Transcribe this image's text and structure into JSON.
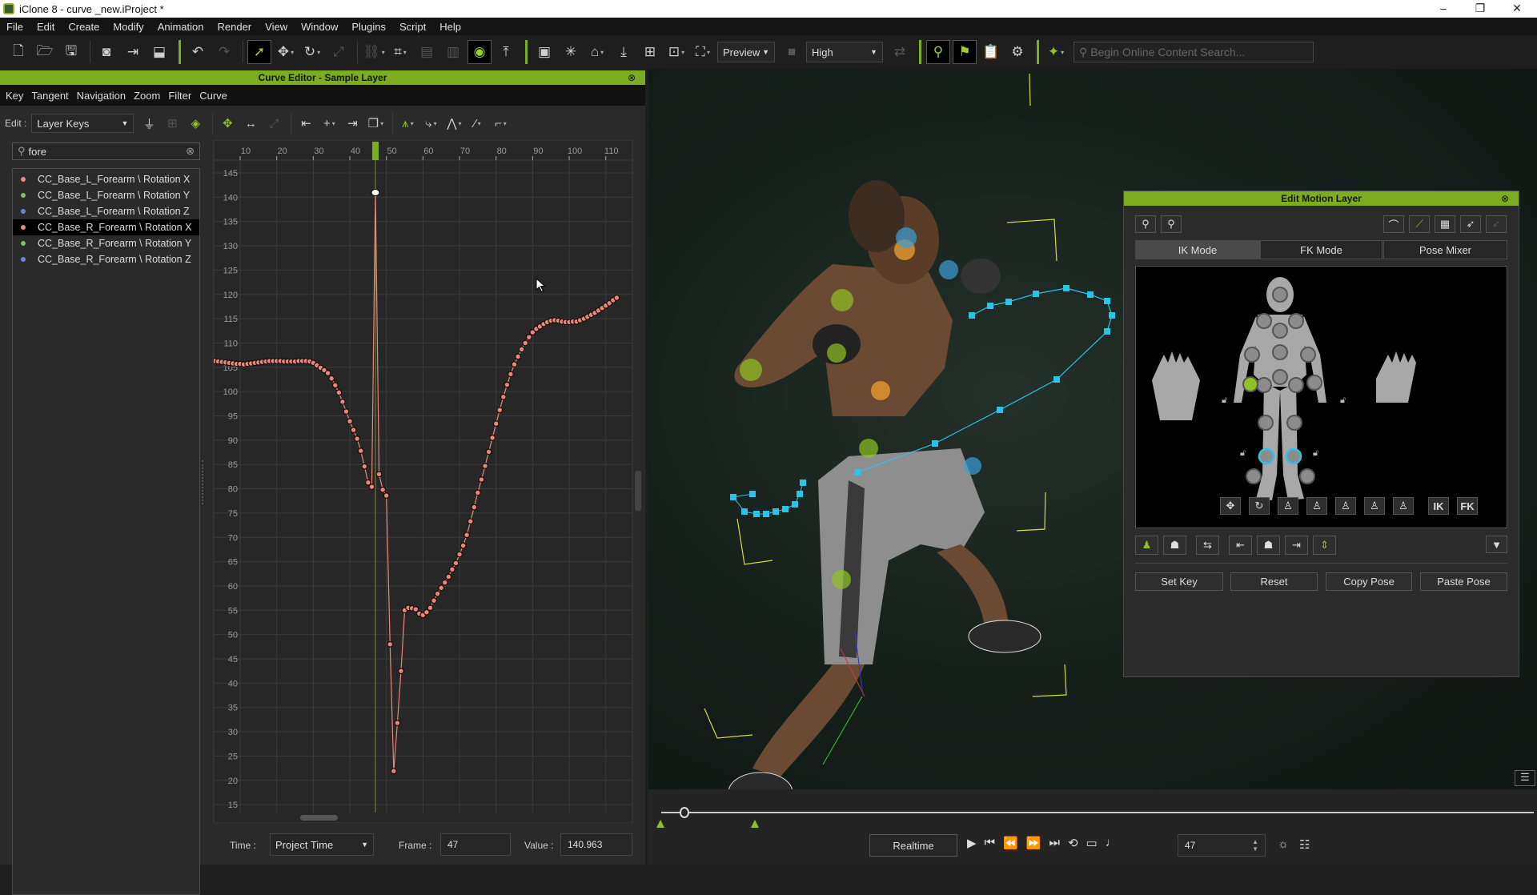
{
  "window": {
    "title": "iClone 8 - curve _new.iProject *",
    "controls": [
      "minimize",
      "maximize",
      "close"
    ]
  },
  "menu": [
    "File",
    "Edit",
    "Create",
    "Modify",
    "Animation",
    "Render",
    "View",
    "Window",
    "Plugins",
    "Script",
    "Help"
  ],
  "toolbar": {
    "groups": [
      [
        {
          "icon": "new-file-icon",
          "g": "🗋"
        },
        {
          "icon": "open-folder-icon",
          "g": "🗁"
        },
        {
          "icon": "save-icon",
          "g": "🖫"
        }
      ],
      [
        {
          "icon": "preview-render-icon",
          "g": "◙"
        },
        {
          "icon": "export-icon",
          "g": "⇥"
        },
        {
          "icon": "export-usd-icon",
          "g": "⬓"
        }
      ],
      "gsep",
      [
        {
          "icon": "undo-icon",
          "g": "↶"
        },
        {
          "icon": "redo-icon",
          "g": "↷",
          "dis": true
        }
      ],
      [
        {
          "icon": "select-icon",
          "g": "➚",
          "act": true
        },
        {
          "icon": "move-icon",
          "g": "✥",
          "dd": true
        },
        {
          "icon": "rotate-icon",
          "g": "↻",
          "dd": true
        },
        {
          "icon": "scale-icon",
          "g": "⤢",
          "dis": true
        }
      ],
      [
        {
          "icon": "link-icon",
          "g": "⛓",
          "dd": true,
          "dis": true
        },
        {
          "icon": "snap-icon",
          "g": "⌗",
          "dd": true
        },
        {
          "icon": "align-left-icon",
          "g": "▤",
          "dis": true
        },
        {
          "icon": "align-right-icon",
          "g": "▥",
          "dis": true
        },
        {
          "icon": "visibility-eye-icon",
          "g": "◉",
          "act": true
        },
        {
          "icon": "pivot-icon",
          "g": "⤒"
        }
      ],
      "gsep",
      [
        {
          "icon": "frame-icon",
          "g": "▣"
        },
        {
          "icon": "light-icon",
          "g": "✳"
        },
        {
          "icon": "home-camera-icon",
          "g": "⌂",
          "dd": true
        },
        {
          "icon": "drop-to-floor-icon",
          "g": "⤓"
        },
        {
          "icon": "center-icon",
          "g": "⊞"
        },
        {
          "icon": "pick-camera-icon",
          "g": "⊡",
          "dd": true
        },
        {
          "icon": "fit-view-icon",
          "g": "⛶",
          "dd": true
        }
      ],
      "preview",
      "camera",
      "high",
      [
        {
          "icon": "sync-icon",
          "g": "⇄",
          "dis": true
        }
      ],
      "gsep",
      [
        {
          "icon": "motion-trail-icon",
          "g": "⚲",
          "act": true
        },
        {
          "icon": "flag-icon",
          "g": "⚑",
          "act": true
        },
        {
          "icon": "clipboard-icon",
          "g": "📋"
        },
        {
          "icon": "gizmo-icon",
          "g": "⚙"
        }
      ],
      "gsep",
      [
        {
          "icon": "plugin-icon",
          "g": "✦",
          "dd": true,
          "green": true
        }
      ],
      "search"
    ],
    "preview_label": "Preview",
    "quality_label": "High",
    "search_placeholder": "Begin Online Content Search..."
  },
  "curve_editor": {
    "title": "Curve Editor - Sample Layer",
    "menu": [
      "Key",
      "Tangent",
      "Navigation",
      "Zoom",
      "Filter",
      "Curve"
    ],
    "edit_label": "Edit :",
    "edit_mode": "Layer Keys",
    "search_value": "fore",
    "channels": [
      {
        "label": "CC_Base_L_Forearm \\ Rotation X",
        "color": "#e58a80",
        "selected": false
      },
      {
        "label": "CC_Base_L_Forearm \\ Rotation Y",
        "color": "#7fbf6a",
        "selected": false
      },
      {
        "label": "CC_Base_L_Forearm \\ Rotation Z",
        "color": "#6f86d6",
        "selected": false
      },
      {
        "label": "CC_Base_R_Forearm \\ Rotation X",
        "color": "#e58a80",
        "selected": true
      },
      {
        "label": "CC_Base_R_Forearm \\ Rotation Y",
        "color": "#7fbf6a",
        "selected": false
      },
      {
        "label": "CC_Base_R_Forearm \\ Rotation Z",
        "color": "#6f86d6",
        "selected": false
      }
    ],
    "time_label": "Time :",
    "time_mode": "Project Time",
    "frame_label": "Frame :",
    "frame_value": "47",
    "value_label": "Value :",
    "value_value": "140.963"
  },
  "chart_data": {
    "type": "line",
    "series": [
      {
        "channel": "CC_Base_R_Forearm \\ Rotation X",
        "color": "#e8877c",
        "x": [
          3,
          4,
          5,
          6,
          7,
          8,
          9,
          10,
          11,
          12,
          13,
          14,
          15,
          16,
          17,
          18,
          19,
          20,
          21,
          22,
          23,
          24,
          25,
          26,
          27,
          28,
          29,
          30,
          31,
          32,
          33,
          34,
          35,
          36,
          37,
          38,
          39,
          40,
          41,
          42,
          43,
          44,
          45,
          46,
          47,
          48,
          49,
          50,
          51,
          52,
          53,
          54,
          55,
          56,
          57,
          58,
          59,
          60,
          61,
          62,
          63,
          64,
          65,
          66,
          67,
          68,
          69,
          70,
          71,
          72,
          73,
          74,
          75,
          76,
          77,
          78,
          79,
          80,
          81,
          82,
          83,
          84,
          85,
          86,
          87,
          88,
          89,
          90,
          91,
          92,
          93,
          94,
          95,
          96,
          97,
          98,
          99,
          100,
          101,
          102,
          103,
          104,
          105,
          106,
          107,
          108,
          109,
          110,
          111,
          112,
          113
        ],
        "y": [
          106.3,
          106.2,
          106.1,
          106.0,
          105.9,
          105.8,
          105.7,
          105.7,
          105.6,
          105.7,
          105.8,
          105.9,
          106.0,
          106.1,
          106.2,
          106.3,
          106.3,
          106.3,
          106.3,
          106.2,
          106.2,
          106.2,
          106.2,
          106.3,
          106.3,
          106.3,
          106.2,
          105.9,
          105.4,
          104.9,
          104.4,
          103.8,
          102.7,
          101.3,
          99.8,
          97.9,
          95.9,
          93.9,
          92.1,
          90.3,
          87.8,
          84.6,
          81.3,
          80.4,
          140.963,
          83.0,
          79.8,
          78.6,
          48.0,
          21.9,
          31.8,
          42.5,
          55.0,
          55.5,
          55.4,
          55.2,
          54.3,
          54.0,
          54.6,
          55.5,
          57.0,
          58.4,
          59.6,
          60.7,
          61.9,
          63.4,
          64.7,
          66.5,
          68.3,
          70.5,
          73.3,
          76.2,
          79.2,
          81.9,
          84.7,
          87.6,
          90.5,
          93.4,
          96.2,
          98.9,
          101.4,
          103.6,
          105.6,
          107.2,
          108.7,
          110.0,
          111.2,
          112.2,
          112.9,
          113.4,
          113.9,
          114.3,
          114.6,
          114.7,
          114.6,
          114.4,
          114.3,
          114.3,
          114.4,
          114.4,
          114.7,
          115.0,
          115.4,
          115.8,
          116.2,
          116.7,
          117.2,
          117.7,
          118.2,
          118.8,
          119.3
        ]
      }
    ],
    "selected_key": {
      "frame": 47,
      "value": 140.963
    },
    "current_frame": 47,
    "xlim": [
      3,
      113
    ],
    "ylim": [
      13,
      148
    ],
    "x_ticks": [
      10,
      20,
      30,
      40,
      50,
      60,
      70,
      80,
      90,
      100,
      110
    ],
    "y_ticks": [
      15,
      20,
      25,
      30,
      35,
      40,
      45,
      50,
      55,
      60,
      65,
      70,
      75,
      80,
      85,
      90,
      95,
      100,
      105,
      110,
      115,
      120,
      125,
      130,
      135,
      140,
      145
    ],
    "grid": true,
    "playhead_color": "#7cad1e"
  },
  "edit_motion_layer": {
    "title": "Edit Motion Layer",
    "tabs": [
      {
        "label": "IK Mode",
        "active": true
      },
      {
        "label": "FK Mode",
        "active": false
      },
      {
        "label": "Pose Mixer",
        "active": false
      }
    ],
    "ik_label": "IK",
    "fk_label": "FK",
    "buttons": {
      "set_key": "Set Key",
      "reset": "Reset",
      "copy_pose": "Copy Pose",
      "paste_pose": "Paste Pose"
    }
  },
  "playback": {
    "mode": "Realtime",
    "frame": "47"
  }
}
